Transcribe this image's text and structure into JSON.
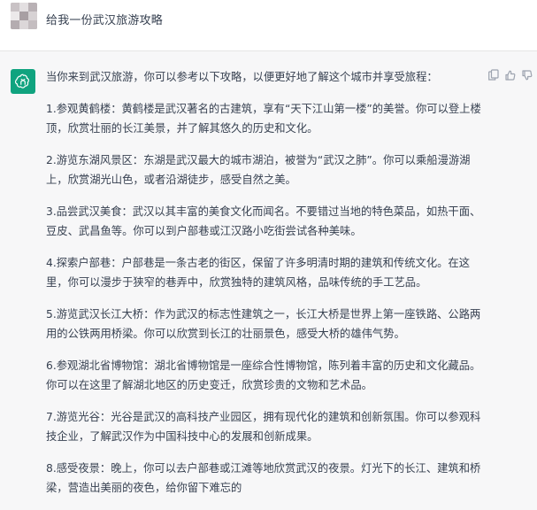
{
  "user_message": {
    "text": "给我一份武汉旅游攻略"
  },
  "assistant_message": {
    "intro": "当你来到武汉旅游，你可以参考以下攻略，以便更好地了解这个城市并享受旅程：",
    "items": [
      "1.参观黄鹤楼：黄鹤楼是武汉著名的古建筑，享有“天下江山第一楼”的美誉。你可以登上楼顶，欣赏壮丽的长江美景，并了解其悠久的历史和文化。",
      "2.游览东湖风景区：东湖是武汉最大的城市湖泊，被誉为“武汉之肺”。你可以乘船漫游湖上，欣赏湖光山色，或者沿湖徒步，感受自然之美。",
      "3.品尝武汉美食：武汉以其丰富的美食文化而闻名。不要错过当地的特色菜品，如热干面、豆皮、武昌鱼等。你可以到户部巷或江汉路小吃街尝试各种美味。",
      "4.探索户部巷：户部巷是一条古老的街区，保留了许多明清时期的建筑和传统文化。在这里，你可以漫步于狭窄的巷弄中，欣赏独特的建筑风格，品味传统的手工艺品。",
      "5.游览武汉长江大桥：作为武汉的标志性建筑之一，长江大桥是世界上第一座铁路、公路两用的公铁两用桥梁。你可以欣赏到长江的壮丽景色，感受大桥的雄伟气势。",
      "6.参观湖北省博物馆：湖北省博物馆是一座综合性博物馆，陈列着丰富的历史和文化藏品。你可以在这里了解湖北地区的历史变迁，欣赏珍贵的文物和艺术品。",
      "7.游览光谷：光谷是武汉的高科技产业园区，拥有现代化的建筑和创新氛围。你可以参观科技企业，了解武汉作为中国科技中心的发展和创新成果。",
      "8.感受夜景：晚上，你可以去户部巷或江滩等地欣赏武汉的夜景。灯光下的长江、建筑和桥梁，营造出美丽的夜色，给你留下难忘的"
    ]
  },
  "icons": {
    "bot_avatar": "openai-logo-icon",
    "copy": "copy-icon",
    "thumbs_up": "thumbs-up-icon",
    "thumbs_down": "thumbs-down-icon"
  },
  "colors": {
    "accent": "#10a37f",
    "assistant_bg": "#f7f7f8",
    "user_bg": "#ffffff",
    "text": "#374151"
  }
}
